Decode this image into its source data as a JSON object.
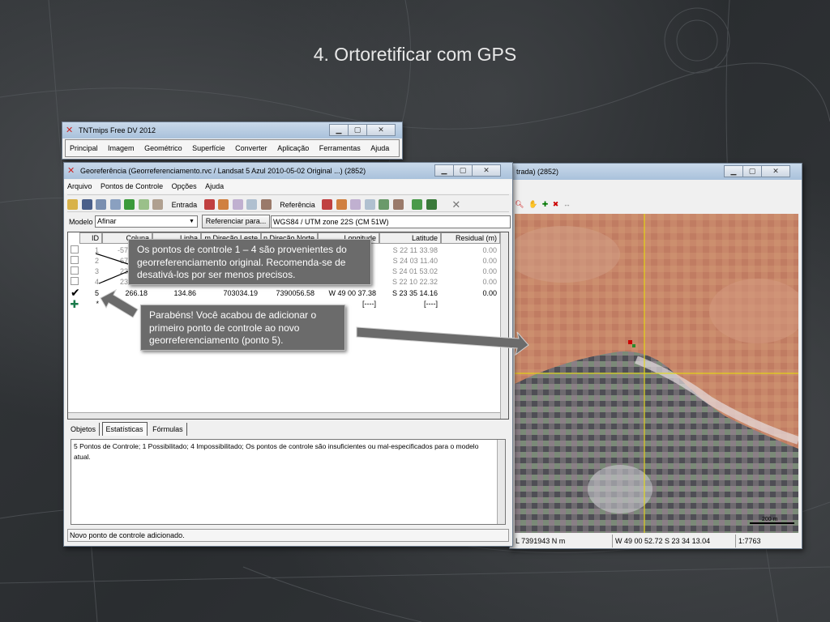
{
  "slide": {
    "title": "4. Ortoretificar com GPS"
  },
  "main_window": {
    "title": "TNTmips Free DV 2012",
    "menu": [
      "Principal",
      "Imagem",
      "Geométrico",
      "Superfície",
      "Converter",
      "Aplicação",
      "Ferramentas",
      "Ajuda"
    ]
  },
  "geo_window": {
    "title": "Georeferência (Georreferenciamento.rvc / Landsat 5 Azul 2010-05-02 Original ...) (2852)",
    "menu": [
      "Arquivo",
      "Pontos de Controle",
      "Opções",
      "Ajuda"
    ],
    "toolbar": {
      "entrada_label": "Entrada",
      "referencia_label": "Referência"
    },
    "model_label": "Modelo",
    "model_value": "Afinar",
    "ref_button": "Referenciar para...",
    "crs": "WGS84 / UTM zone 22S (CM 51W)",
    "columns": [
      "ID",
      "Coluna",
      "Linha",
      "m Direção Leste",
      "n Direção Norte",
      "Longitude",
      "Latitude",
      "Residual (m)"
    ],
    "rows": [
      {
        "id": "1",
        "coluna": "-57",
        "linha": "",
        "leste": "",
        "norte": "",
        "longitude": "",
        "latitude": "S 22 11 33.98",
        "residual": "0.00",
        "checked": false
      },
      {
        "id": "2",
        "coluna": "67",
        "linha": "",
        "leste": "",
        "norte": "",
        "longitude": "",
        "latitude": "S 24 03 11.40",
        "residual": "0.00",
        "checked": false
      },
      {
        "id": "3",
        "coluna": "23",
        "linha": "",
        "leste": "",
        "norte": "",
        "longitude": "",
        "latitude": "S 24 01 53.02",
        "residual": "0.00",
        "checked": false
      },
      {
        "id": "4",
        "coluna": "23",
        "linha": "",
        "leste": "",
        "norte": "",
        "longitude": "",
        "latitude": "S 22 10 22.32",
        "residual": "0.00",
        "checked": false
      },
      {
        "id": "5",
        "coluna": "266.18",
        "linha": "134.86",
        "leste": "703034.19",
        "norte": "7390056.58",
        "longitude": "W 49 00 37.38",
        "latitude": "S 23 35 14.16",
        "residual": "0.00",
        "checked": true
      }
    ],
    "new_row": {
      "id": "*",
      "placeholder_a": "[----]",
      "placeholder_b": "[----]"
    },
    "tabs": [
      "Objetos",
      "Estatísticas",
      "Fórmulas"
    ],
    "message": "5 Pontos de Controle;  1 Possibilitado;  4 Impossibilitado;  Os pontos de controle são insuficientes ou mal-especificados para o modelo atual.",
    "status": "Novo ponto de controle adicionado."
  },
  "view_window": {
    "title": "trada) (2852)",
    "status": {
      "north": "L 7391943 N m",
      "coords": "W 49 00 52.72  S 23 34 13.04",
      "scale": "1:7763"
    },
    "scale_bar": "200 m"
  },
  "callouts": {
    "first": "Os pontos de controle 1 – 4 são provenientes do georreferenciamento original. Recomenda-se de desativá-los por ser menos precisos.",
    "second": "Parabéns! Você acabou de adicionar o primeiro ponto de controle ao novo georreferenciamento (ponto 5)."
  },
  "colors": {
    "callout_bg": "#6b6b6b",
    "titlebar": "#b9cde2",
    "crosshair": "#e8e000"
  }
}
